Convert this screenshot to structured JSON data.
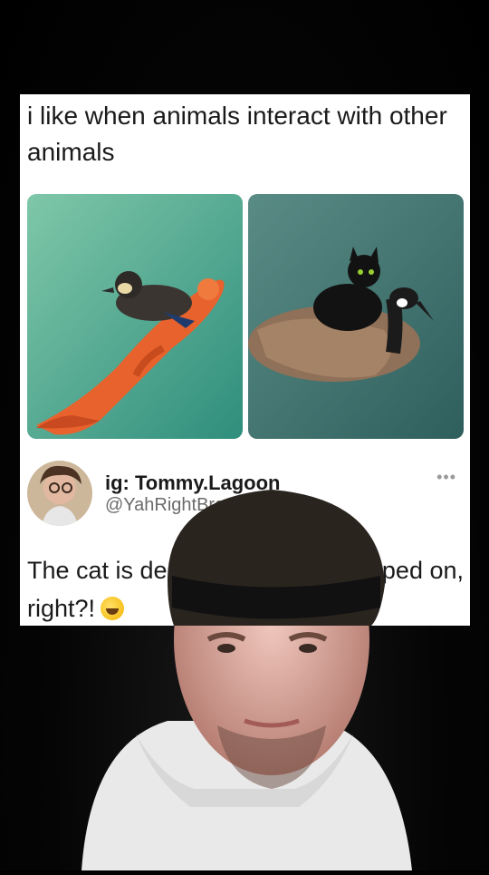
{
  "post": {
    "text": "i like when animals interact with other animals"
  },
  "reply": {
    "handle": "ig: Tommy.Lagoon",
    "username": "@YahRightBra",
    "text_left": "The cat is de",
    "text_right": "ped on,",
    "text_line2": "right?!",
    "more_icon": "more-dots-icon"
  },
  "colors": {
    "background": "#000000",
    "card": "#ffffff",
    "text": "#1a1a1a",
    "secondary_text": "#6b6b6b"
  }
}
